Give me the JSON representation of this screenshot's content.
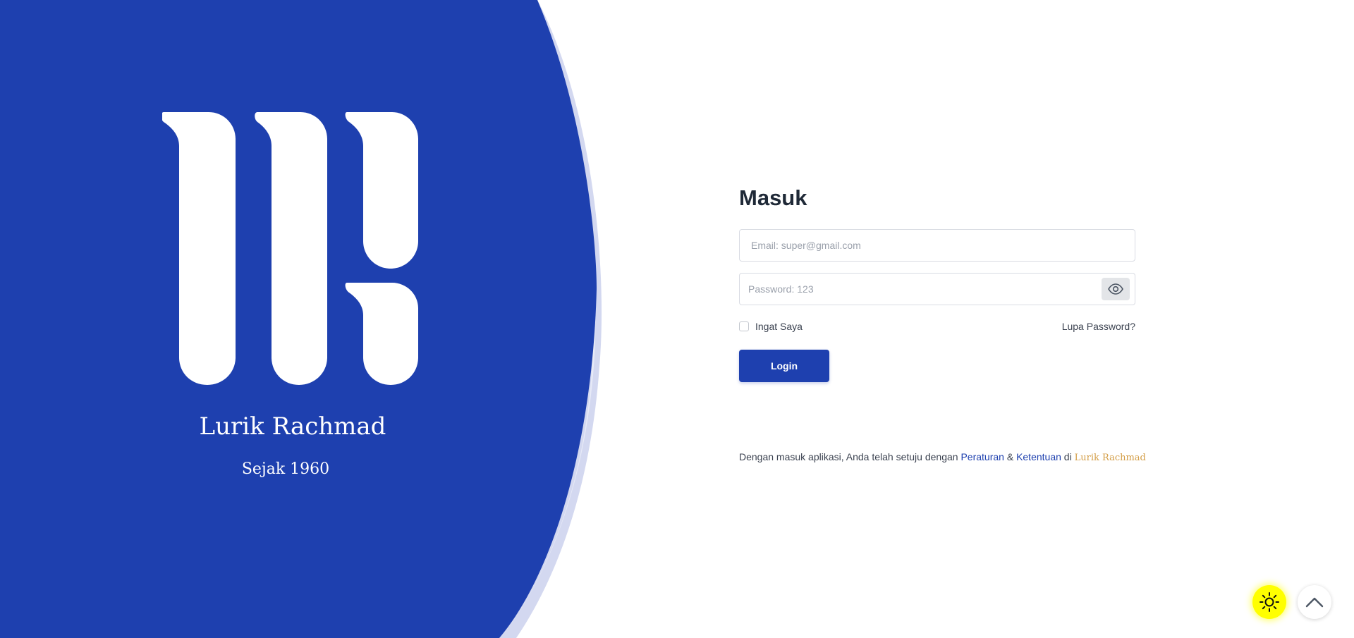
{
  "brand": {
    "name": "Lurik Rachmad",
    "tagline": "Sejak 1960"
  },
  "login": {
    "title": "Masuk",
    "email_placeholder": "Email: super@gmail.com",
    "password_placeholder": "Password: 123",
    "remember_label": "Ingat Saya",
    "forgot_label": "Lupa Password?",
    "submit_label": "Login"
  },
  "terms": {
    "prefix": "Dengan masuk aplikasi, Anda telah setuju dengan",
    "link1": "Peraturan",
    "amp": "&",
    "link2": "Ketentuan",
    "middle": "di",
    "brand": "Lurik Rachmad"
  },
  "floating": {
    "theme_icon": "sun-icon",
    "scroll_icon": "chevron-up-icon"
  },
  "colors": {
    "primary": "#1e40af",
    "accent_light": "#d3d8f0",
    "brand_gold": "#d39d45",
    "theme_toggle_bg": "#ffff00"
  }
}
